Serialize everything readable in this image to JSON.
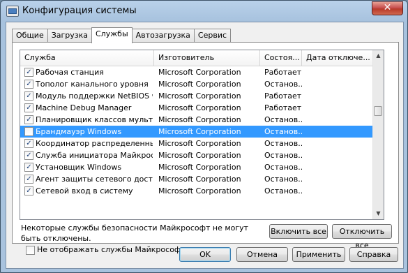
{
  "window": {
    "title": "Конфигурация системы",
    "close_glyph": "✕"
  },
  "tabs": [
    {
      "label": "Общие",
      "active": false
    },
    {
      "label": "Загрузка",
      "active": false
    },
    {
      "label": "Службы",
      "active": true
    },
    {
      "label": "Автозагрузка",
      "active": false
    },
    {
      "label": "Сервис",
      "active": false
    }
  ],
  "services": {
    "columns": [
      "Служба",
      "Изготовитель",
      "Состоя...",
      "Дата отключе..."
    ],
    "rows": [
      {
        "name": "Рабочая станция",
        "maker": "Microsoft Corporation",
        "status": "Работает",
        "checked": true
      },
      {
        "name": "Тополог канального уровня",
        "maker": "Microsoft Corporation",
        "status": "Останов...",
        "checked": true
      },
      {
        "name": "Модуль поддержки NetBIOS ч...",
        "maker": "Microsoft Corporation",
        "status": "Работает",
        "checked": true
      },
      {
        "name": "Machine Debug Manager",
        "maker": "Microsoft Corporation",
        "status": "Работает",
        "checked": true
      },
      {
        "name": "Планировщик классов мульти...",
        "maker": "Microsoft Corporation",
        "status": "Останов...",
        "checked": true
      },
      {
        "name": "Брандмауэр Windows",
        "maker": "Microsoft Corporation",
        "status": "Останов...",
        "checked": false,
        "selected": true
      },
      {
        "name": "Координатор распределенны...",
        "maker": "Microsoft Corporation",
        "status": "Останов...",
        "checked": true
      },
      {
        "name": "Служба инициатора Майкросо...",
        "maker": "Microsoft Corporation",
        "status": "Останов...",
        "checked": true
      },
      {
        "name": "Установщик Windows",
        "maker": "Microsoft Corporation",
        "status": "Останов...",
        "checked": true
      },
      {
        "name": "Агент защиты сетевого доступа",
        "maker": "Microsoft Corporation",
        "status": "Останов...",
        "checked": true
      },
      {
        "name": "Сетевой вход в систему",
        "maker": "Microsoft Corporation",
        "status": "Останов...",
        "checked": true
      }
    ],
    "checkmark_glyph": "✓"
  },
  "scrollbar": {
    "up_glyph": "▲",
    "down_glyph": "▼"
  },
  "note": "Некоторые службы безопасности Майкрософт не могут быть отключены.",
  "enable_all": "Включить все",
  "disable_all": "Отключить все",
  "hide_ms_label": "Не отображать службы Майкрософт",
  "hide_ms_checked": false,
  "buttons": {
    "ok": "OK",
    "cancel": "Отмена",
    "apply": "Применить",
    "help": "Справка"
  }
}
